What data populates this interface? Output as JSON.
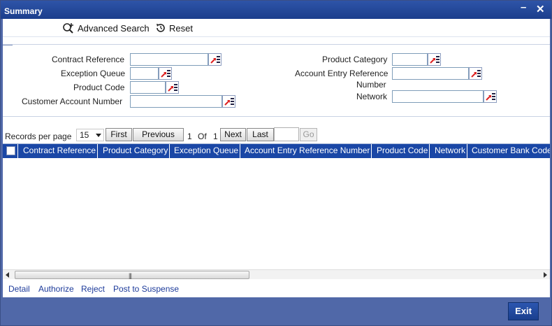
{
  "window": {
    "title": "Summary",
    "minimize_icon": "minimize-icon",
    "close_icon": "close-icon"
  },
  "toolbar": {
    "advanced_search": "Advanced Search",
    "reset": "Reset"
  },
  "criteria": {
    "contract_reference": {
      "label": "Contract Reference",
      "value": ""
    },
    "exception_queue": {
      "label": "Exception Queue",
      "value": ""
    },
    "product_code": {
      "label": "Product Code",
      "value": ""
    },
    "customer_account_number": {
      "label": "Customer Account Number",
      "value": ""
    },
    "product_category": {
      "label": "Product Category",
      "value": ""
    },
    "account_entry_reference_number": {
      "label_line1": "Account Entry Reference",
      "label_line2": "Number",
      "value": ""
    },
    "network": {
      "label": "Network",
      "value": ""
    }
  },
  "pager": {
    "records_per_page_label": "Records per page",
    "records_per_page_value": "15",
    "first": "First",
    "previous": "Previous",
    "current_page": "1",
    "of_label": "Of",
    "total_pages": "1",
    "next": "Next",
    "last": "Last",
    "go": "Go",
    "goto_value": ""
  },
  "grid": {
    "columns": [
      "Contract Reference",
      "Product Category",
      "Exception Queue",
      "Account Entry Reference Number",
      "Product Code",
      "Network",
      "Customer Bank Code"
    ],
    "rows": []
  },
  "actions": [
    "Detail",
    "Authorize",
    "Reject",
    "Post to Suspense"
  ],
  "footer": {
    "exit": "Exit"
  },
  "colors": {
    "title_bar": "#1b3e8c",
    "grid_header": "#1a47a6",
    "frame": "#5068a8",
    "link": "#1c3a9a"
  }
}
